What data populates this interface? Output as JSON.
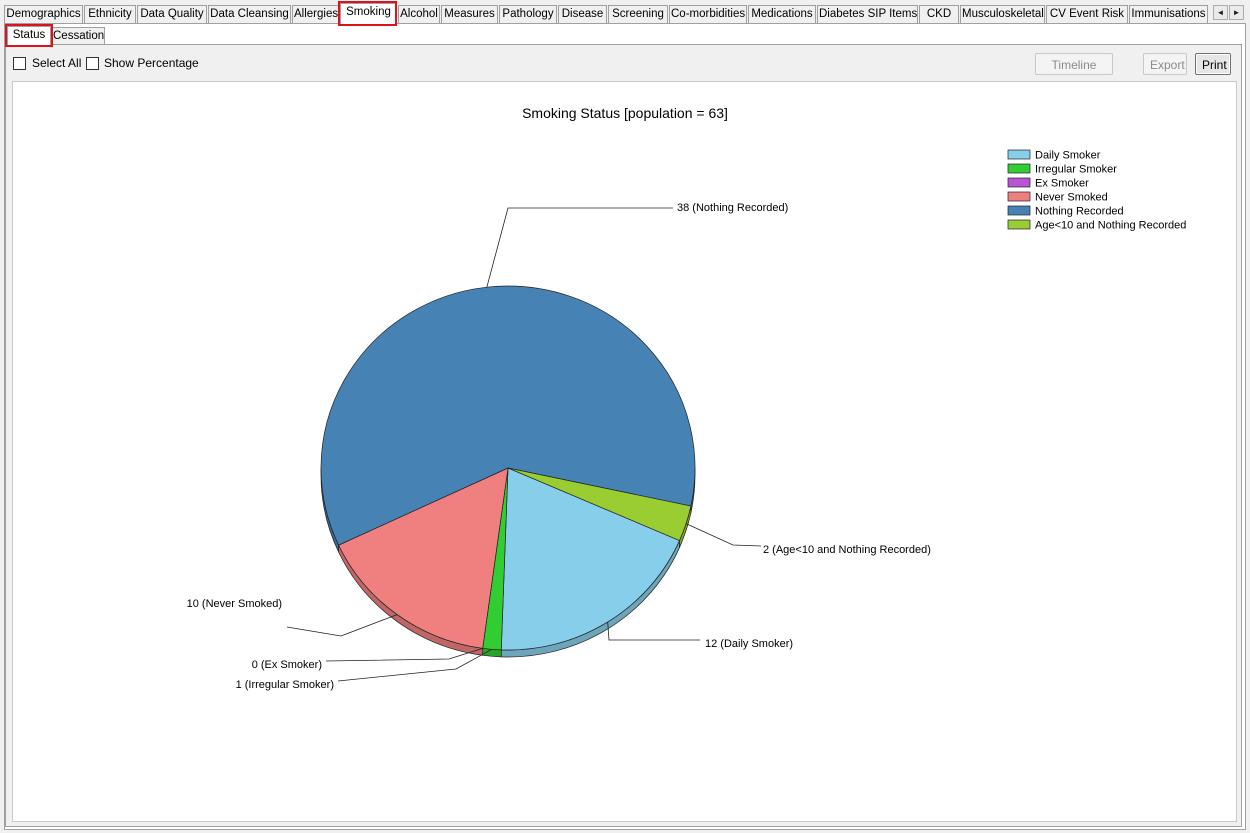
{
  "tabs": [
    {
      "label": "Demographics",
      "active": false
    },
    {
      "label": "Ethnicity",
      "active": false
    },
    {
      "label": "Data Quality",
      "active": false
    },
    {
      "label": "Data Cleansing",
      "active": false
    },
    {
      "label": "Allergies",
      "active": false
    },
    {
      "label": "Smoking",
      "active": true
    },
    {
      "label": "Alcohol",
      "active": false
    },
    {
      "label": "Measures",
      "active": false
    },
    {
      "label": "Pathology",
      "active": false
    },
    {
      "label": "Disease",
      "active": false
    },
    {
      "label": "Screening",
      "active": false
    },
    {
      "label": "Co-morbidities",
      "active": false
    },
    {
      "label": "Medications",
      "active": false
    },
    {
      "label": "Diabetes SIP Items",
      "active": false
    },
    {
      "label": "CKD",
      "active": false
    },
    {
      "label": "Musculoskeletal",
      "active": false
    },
    {
      "label": "CV Event Risk",
      "active": false
    },
    {
      "label": "Immunisations",
      "active": false
    }
  ],
  "tab_scroll": {
    "left_icon": "◄",
    "right_icon": "►"
  },
  "subtabs": [
    {
      "label": "Status",
      "active": true
    },
    {
      "label": "Cessation",
      "active": false
    }
  ],
  "toolbar": {
    "select_all": "Select All",
    "show_percentage": "Show Percentage",
    "timeline": "Timeline",
    "export": "Export",
    "print": "Print"
  },
  "highlight_color": "#d9141c",
  "chart_data": {
    "type": "pie",
    "title": "Smoking Status [population = 63]",
    "total": 63,
    "legend_position": "top-right",
    "slices": [
      {
        "name": "Daily Smoker",
        "value": 12,
        "label": "12 (Daily Smoker)",
        "color": "#87ceeb"
      },
      {
        "name": "Irregular Smoker",
        "value": 1,
        "label": "1 (Irregular Smoker)",
        "color": "#32cd32"
      },
      {
        "name": "Ex Smoker",
        "value": 0,
        "label": "0 (Ex Smoker)",
        "color": "#ba55d3"
      },
      {
        "name": "Never Smoked",
        "value": 10,
        "label": "10 (Never Smoked)",
        "color": "#f08080"
      },
      {
        "name": "Nothing Recorded",
        "value": 38,
        "label": "38 (Nothing Recorded)",
        "color": "#4682b4"
      },
      {
        "name": "Age<10 and Nothing Recorded",
        "value": 2,
        "label": "2 (Age<10 and Nothing Recorded)",
        "color": "#9acd32"
      }
    ]
  }
}
